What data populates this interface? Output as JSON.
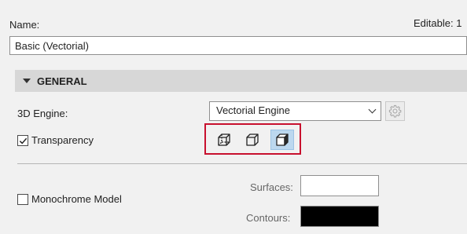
{
  "header": {
    "name_label": "Name:",
    "editable_label": "Editable: 1"
  },
  "name_field": {
    "value": "Basic (Vectorial)"
  },
  "section": {
    "title": "GENERAL"
  },
  "engine": {
    "label": "3D Engine:",
    "selected": "Vectorial Engine",
    "gear_icon": "gear-icon"
  },
  "transparency": {
    "label": "Transparency",
    "checked": true
  },
  "display_modes": {
    "buttons": [
      {
        "icon": "wireframe-cube-icon",
        "selected": false
      },
      {
        "icon": "hidden-line-cube-icon",
        "selected": false
      },
      {
        "icon": "shaded-cube-icon",
        "selected": true
      }
    ],
    "highlight_color": "#c8102e",
    "selected_bg": "#bcd8ef"
  },
  "monochrome": {
    "label": "Monochrome Model",
    "checked": false,
    "surfaces_label": "Surfaces:",
    "surfaces_color": "#ffffff",
    "contours_label": "Contours:",
    "contours_color": "#000000"
  }
}
